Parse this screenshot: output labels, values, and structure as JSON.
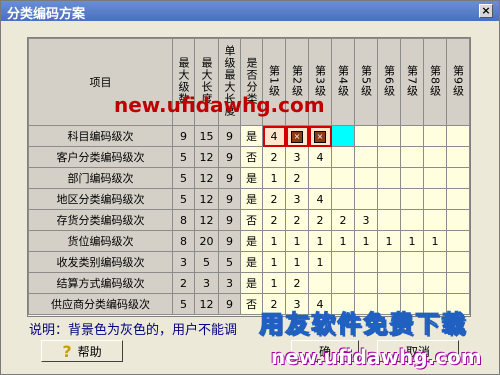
{
  "window": {
    "title": "分类编码方案",
    "close_label": "×"
  },
  "grid": {
    "headers": [
      "项目",
      "最大级数",
      "最大长度",
      "单级最大长度",
      "是否分类"
    ],
    "level_headers": [
      "第1级",
      "第2级",
      "第3级",
      "第4级",
      "第5级",
      "第6级",
      "第7级",
      "第8级",
      "第9级"
    ],
    "rows": [
      {
        "name": "科目编码级次",
        "max_levels": "9",
        "max_len": "15",
        "single_max": "9",
        "classify": "是",
        "levels": [
          "4",
          "",
          "",
          "",
          "",
          "",
          "",
          "",
          ""
        ]
      },
      {
        "name": "客户分类编码级次",
        "max_levels": "5",
        "max_len": "12",
        "single_max": "9",
        "classify": "否",
        "levels": [
          "2",
          "3",
          "4",
          "",
          "",
          "",
          "",
          "",
          ""
        ]
      },
      {
        "name": "部门编码级次",
        "max_levels": "5",
        "max_len": "12",
        "single_max": "9",
        "classify": "是",
        "levels": [
          "1",
          "2",
          "",
          "",
          "",
          "",
          "",
          "",
          ""
        ]
      },
      {
        "name": "地区分类编码级次",
        "max_levels": "5",
        "max_len": "12",
        "single_max": "9",
        "classify": "是",
        "levels": [
          "2",
          "3",
          "4",
          "",
          "",
          "",
          "",
          "",
          ""
        ]
      },
      {
        "name": "存货分类编码级次",
        "max_levels": "8",
        "max_len": "12",
        "single_max": "9",
        "classify": "否",
        "levels": [
          "2",
          "2",
          "2",
          "2",
          "3",
          "",
          "",
          "",
          ""
        ]
      },
      {
        "name": "货位编码级次",
        "max_levels": "8",
        "max_len": "20",
        "single_max": "9",
        "classify": "是",
        "levels": [
          "1",
          "1",
          "1",
          "1",
          "1",
          "1",
          "1",
          "1",
          ""
        ]
      },
      {
        "name": "收发类别编码级次",
        "max_levels": "3",
        "max_len": "5",
        "single_max": "5",
        "classify": "是",
        "levels": [
          "1",
          "1",
          "1",
          "",
          "",
          "",
          "",
          "",
          ""
        ]
      },
      {
        "name": "结算方式编码级次",
        "max_levels": "2",
        "max_len": "3",
        "single_max": "3",
        "classify": "是",
        "levels": [
          "1",
          "2",
          "",
          "",
          "",
          "",
          "",
          "",
          ""
        ]
      },
      {
        "name": "供应商分类编码级次",
        "max_levels": "5",
        "max_len": "12",
        "single_max": "9",
        "classify": "否",
        "levels": [
          "2",
          "3",
          "4",
          "",
          "",
          "",
          "",
          "",
          ""
        ]
      }
    ]
  },
  "note": "说明：背景色为灰色的，用户不能调",
  "buttons": {
    "help": "帮助",
    "ok": "确",
    "cancel": "取消"
  },
  "watermarks": {
    "top": "new.ufidawhg.com",
    "brand": "用友软件免费下载",
    "bottom": "new.ufidawhg.com"
  },
  "colors": {
    "title_bar": "#4a6fc0",
    "cell_bg": "#ffffe0",
    "header_bg": "#d4d0c8",
    "selection": "#d40000",
    "cursor_cell": "#00ffff"
  },
  "icons": {
    "help": "question-mark-icon",
    "hatched": "hatched-cell-icon"
  }
}
